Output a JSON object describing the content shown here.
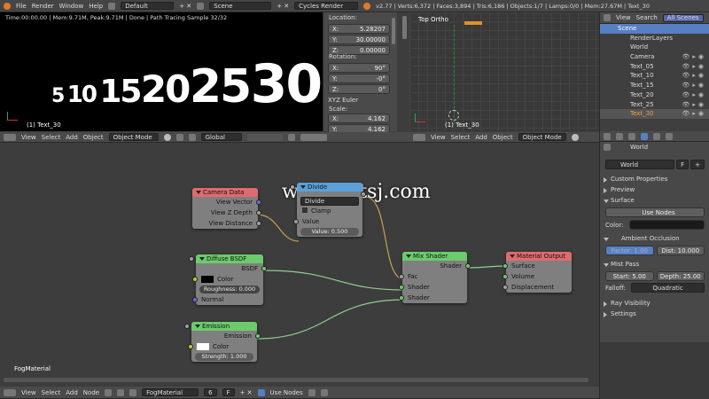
{
  "topbar": {
    "menus": [
      "File",
      "Render",
      "Window",
      "Help"
    ],
    "layout": "Default",
    "scene": "Scene",
    "engine": "Cycles Render",
    "stats": "v2.77 | Verts:6,372 | Faces:3,894 | Tris:6,186 | Objects:1/7 | Lamps:0/0 | Mem:27.67M | Text_30"
  },
  "render_view": {
    "status": "Time:00:00.00 | Mem:9.71M, Peak:9.71M | Done | Path Tracing Sample 32/32",
    "numbers": [
      "5",
      "10",
      "15",
      "20",
      "25",
      "30"
    ],
    "object_label": "(1) Text_30"
  },
  "transform": {
    "location_label": "Location:",
    "loc": [
      {
        "axis": "X:",
        "val": "5.28207"
      },
      {
        "axis": "Y:",
        "val": "30.00000"
      },
      {
        "axis": "Z:",
        "val": "0.00000"
      }
    ],
    "rotation_label": "Rotation:",
    "rot": [
      {
        "axis": "X:",
        "val": "90°"
      },
      {
        "axis": "Y:",
        "val": "-0°"
      },
      {
        "axis": "Z:",
        "val": "0°"
      }
    ],
    "euler": "XYZ Euler",
    "scale_label": "Scale:",
    "scale": [
      {
        "axis": "X:",
        "val": "4.162"
      },
      {
        "axis": "Y:",
        "val": "4.162"
      }
    ]
  },
  "viewport": {
    "title": "Top Ortho",
    "object_label": "(1) Text_30"
  },
  "view3d_header": {
    "menus": [
      "View",
      "Select",
      "Add",
      "Object"
    ],
    "mode": "Object Mode",
    "orientation": "Global"
  },
  "view3d_header2": {
    "menus": [
      "View",
      "Select",
      "Add",
      "Object"
    ],
    "mode": "Object Mode"
  },
  "outliner": {
    "menus": [
      "View",
      "Search"
    ],
    "filter": "All Scenes",
    "items": [
      "Scene",
      "RenderLayers",
      "World",
      "Camera",
      "Text_05",
      "Text_10",
      "Text_15",
      "Text_20",
      "Text_25",
      "Text_30"
    ]
  },
  "watermark": "www.cgtsj.com",
  "nodes": {
    "camera": {
      "title": "Camera Data",
      "outputs": [
        "View Vector",
        "View Z Depth",
        "View Distance"
      ]
    },
    "divide": {
      "title": "Divide",
      "mode": "Divide",
      "clamp": "Clamp",
      "value_label": "Value",
      "field": "Value:",
      "field_val": "0.500"
    },
    "diffuse": {
      "title": "Diffuse BSDF",
      "out": "BSDF",
      "color": "Color",
      "rough": "Roughness:",
      "rough_val": "0.000",
      "normal": "Normal"
    },
    "emission": {
      "title": "Emission",
      "out": "Emission",
      "color": "Color",
      "strength": "Strength:",
      "strength_val": "1.000"
    },
    "mix": {
      "title": "Mix Shader",
      "out": "Shader",
      "fac": "Fac",
      "sh1": "Shader",
      "sh2": "Shader"
    },
    "output": {
      "title": "Material Output",
      "surface": "Surface",
      "volume": "Volume",
      "displacement": "Displacement"
    },
    "material_label": "FogMaterial"
  },
  "node_header": {
    "menus": [
      "View",
      "Select",
      "Add",
      "Node"
    ],
    "material": "FogMaterial",
    "users": "6",
    "fake": "F",
    "use_nodes": "Use Nodes"
  },
  "properties": {
    "world_path": "World",
    "world_name": "World",
    "fake": "F",
    "sections": {
      "custom": "Custom Properties",
      "preview": "Preview",
      "surface": "Surface",
      "use_nodes": "Use Nodes",
      "color": "Color:",
      "ao": "Ambient Occlusion",
      "factor": "Factor:",
      "factor_val": "1.00",
      "dist": "Dist:",
      "dist_val": "10.000",
      "mist": "Mist Pass",
      "start": "Start:",
      "start_val": "5.00",
      "depth": "Depth:",
      "depth_val": "25.00",
      "falloff": "Falloff:",
      "falloff_val": "Quadratic",
      "ray": "Ray Visibility",
      "settings": "Settings"
    }
  },
  "colors": {
    "camera": "#e06a70",
    "divide": "#5aa0d8",
    "shader": "#6ccb6c",
    "output": "#e06a70"
  }
}
